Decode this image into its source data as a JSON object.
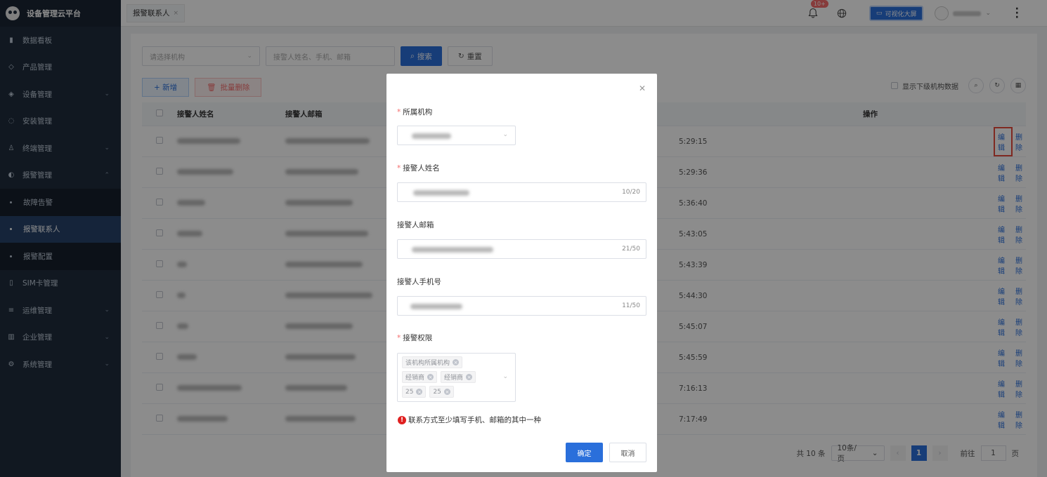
{
  "app": {
    "title": "设备管理云平台"
  },
  "sidebar": {
    "items": [
      {
        "label": "数据看板",
        "icon": "chart-bar-icon",
        "chevron": false
      },
      {
        "label": "产品管理",
        "icon": "cube-icon",
        "chevron": false
      },
      {
        "label": "设备管理",
        "icon": "layers-icon",
        "chevron": true
      },
      {
        "label": "安装管理",
        "icon": "wrench-icon",
        "chevron": false
      },
      {
        "label": "终端管理",
        "icon": "person-icon",
        "chevron": true
      },
      {
        "label": "报警管理",
        "icon": "alarm-icon",
        "chevron": true
      },
      {
        "label": "故障告警",
        "sub": true
      },
      {
        "label": "报警联系人",
        "sub": true,
        "active": true
      },
      {
        "label": "报警配置",
        "sub": true
      },
      {
        "label": "SIM卡管理",
        "icon": "sim-card-icon",
        "chevron": false
      },
      {
        "label": "运维管理",
        "icon": "tool-icon",
        "chevron": true
      },
      {
        "label": "企业管理",
        "icon": "building-icon",
        "chevron": true
      },
      {
        "label": "系统管理",
        "icon": "gear-icon",
        "chevron": true
      }
    ]
  },
  "topbar": {
    "tab_label": "报警联系人",
    "notification_badge": "10+",
    "bigscreen_label": "可视化大屏"
  },
  "filters": {
    "org_placeholder": "请选择机构",
    "search_placeholder": "接警人姓名、手机、邮箱",
    "search_button": "搜索",
    "reset_button": "重置"
  },
  "toolbar": {
    "add_button": "+ 新增",
    "batch_delete_button": "批量删除",
    "show_sub_org_label": "显示下级机构数据"
  },
  "table": {
    "headers": {
      "name": "接警人姓名",
      "email": "接警人邮箱",
      "ops": "操作"
    },
    "edit_label": "编辑",
    "delete_label": "删除",
    "rows": [
      {
        "time": "5:29:15"
      },
      {
        "time": "5:29:36"
      },
      {
        "time": "5:36:40"
      },
      {
        "time": "5:43:05"
      },
      {
        "time": "5:43:39"
      },
      {
        "time": "5:44:30"
      },
      {
        "time": "5:45:07"
      },
      {
        "time": "5:45:59"
      },
      {
        "time": "7:16:13"
      },
      {
        "time": "7:17:49"
      }
    ]
  },
  "pagination": {
    "total": "共 10 条",
    "page_size": "10条/页",
    "current_page": "1",
    "goto_prefix": "前往",
    "goto_value": "1",
    "goto_suffix": "页"
  },
  "modal": {
    "org_label": "所属机构",
    "name_label": "接警人姓名",
    "name_count": "10/20",
    "email_label": "接警人邮箱",
    "email_count": "21/50",
    "phone_label": "接警人手机号",
    "phone_count": "11/50",
    "permission_label": "接警权限",
    "tags": [
      [
        "该机构所属机构"
      ],
      [
        "经销商",
        "经销商"
      ],
      [
        "25",
        "25"
      ]
    ],
    "hint": "联系方式至少填写手机、邮箱的其中一种",
    "confirm_button": "确定",
    "cancel_button": "取消"
  }
}
